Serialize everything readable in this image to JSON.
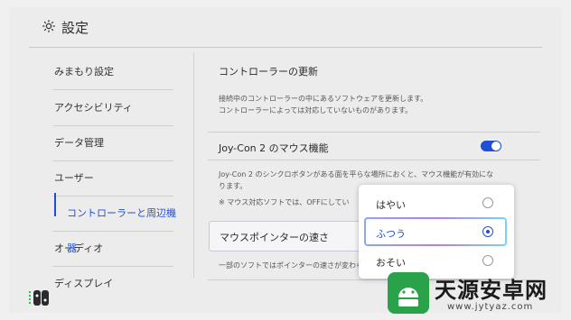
{
  "header": {
    "title": "設定",
    "icon": "gear-icon"
  },
  "sidebar": {
    "items": [
      {
        "label": "みまもり設定"
      },
      {
        "label": "アクセシビリティ"
      },
      {
        "label": "データ管理"
      },
      {
        "label": "ユーザー"
      },
      {
        "label": "コントローラーと周辺機器",
        "active": true
      },
      {
        "label": "オーディオ"
      },
      {
        "label": "ディスプレイ"
      }
    ]
  },
  "content": {
    "update": {
      "title": "コントローラーの更新",
      "desc1": "接続中のコントローラーの中にあるソフトウェアを更新します。",
      "desc2": "コントローラーによっては対応していないものがあります。"
    },
    "mouse_function": {
      "title": "Joy-Con 2 のマウス機能",
      "enabled": true,
      "desc1": "Joy-Con 2 のシンクロボタンがある面を平らな場所におくと、マウス機能が有効にな",
      "desc2": "ります。",
      "note": "※ マウス対応ソフトでは、OFFにしてい"
    },
    "pointer_speed": {
      "title": "マウスポインターの速さ",
      "desc": "一部のソフトではポインターの速さが変わら"
    }
  },
  "dropdown": {
    "options": [
      {
        "label": "はやい",
        "selected": false
      },
      {
        "label": "ふつう",
        "selected": true
      },
      {
        "label": "おそい",
        "selected": false
      }
    ]
  },
  "colors": {
    "accent": "#1e4fd6",
    "background": "#ececec"
  },
  "watermark": {
    "title": "天源安卓网",
    "url": "www.jytyaz.com"
  }
}
